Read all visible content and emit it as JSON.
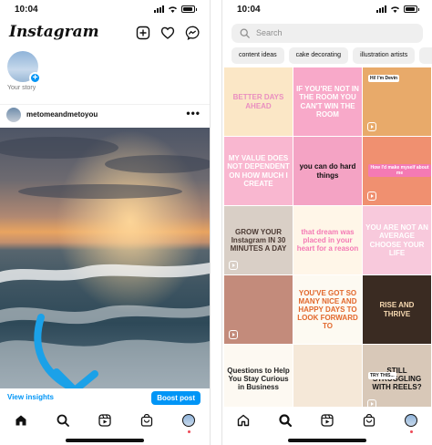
{
  "left": {
    "status_time": "10:04",
    "app_title": "Instagram",
    "story": {
      "label": "Your story"
    },
    "post": {
      "username": "metomeandmetoyou",
      "more_label": "•••",
      "view_insights": "View insights",
      "boost_label": "Boost post"
    },
    "nav": [
      "home-icon",
      "search-icon",
      "reels-icon",
      "shop-icon",
      "profile-avatar"
    ]
  },
  "right": {
    "status_time": "10:04",
    "search": {
      "placeholder": "Search"
    },
    "chips": [
      "content ideas",
      "cake decorating",
      "illustration artists"
    ],
    "grid": [
      {
        "text": "BETTER DAYS AHEAD",
        "bg": "#fbe7c6",
        "fg": "#ea8fc0"
      },
      {
        "text": "IF YOU'RE NOT IN THE ROOM YOU CAN'T WIN THE ROOM",
        "bg": "#f8a9c9",
        "fg": "#ffffff"
      },
      {
        "text": "",
        "bg": "#e8aa6a",
        "fg": "#ffffff",
        "tag": "Hi! I'm Devin"
      },
      {
        "text": "MY VALUE DOES NOT DEPENDENT ON HOW MUCH I CREATE",
        "bg": "#f9b7d0",
        "fg": "#ffffff"
      },
      {
        "text": "you can do hard things",
        "bg": "#f4a3c4",
        "fg": "#111111"
      },
      {
        "text": "",
        "bg": "#f09070",
        "fg": "#ffffff",
        "tag": "How I'd make myself about me"
      },
      {
        "text": "GROW YOUR Instagram IN 30 MINUTES A DAY",
        "bg": "#d9cfc6",
        "fg": "#4b3a33"
      },
      {
        "text": "that dream was placed in your heart for a reason",
        "bg": "#fff6e8",
        "fg": "#f47ab4"
      },
      {
        "text": "YOU ARE NOT AN AVERAGE CHOOSE YOUR LIFE",
        "bg": "#f8c9dc",
        "fg": "#ffffff"
      },
      {
        "text": "",
        "bg": "#c38b7b",
        "fg": "#ffffff",
        "tag": ""
      },
      {
        "text": "YOU'VE GOT SO MANY NICE AND HAPPY DAYS TO LOOK FORWARD TO",
        "bg": "#fdfaf2",
        "fg": "#e2682c"
      },
      {
        "text": "RISE AND THRIVE",
        "bg": "#3a2b22",
        "fg": "#f7d9b1"
      },
      {
        "text": "Questions to Help You Stay Curious in Business",
        "bg": "#fdf9f2",
        "fg": "#222222"
      },
      {
        "text": "",
        "bg": "#f5e8d8",
        "fg": "#b23b36"
      },
      {
        "text": "STILL STRUGGLING WITH REELS?",
        "bg": "#d8c8b8",
        "fg": "#111111",
        "tag": "TRY THIS..."
      }
    ],
    "nav": [
      "home-icon",
      "search-icon",
      "reels-icon",
      "shop-icon",
      "profile-avatar"
    ]
  }
}
